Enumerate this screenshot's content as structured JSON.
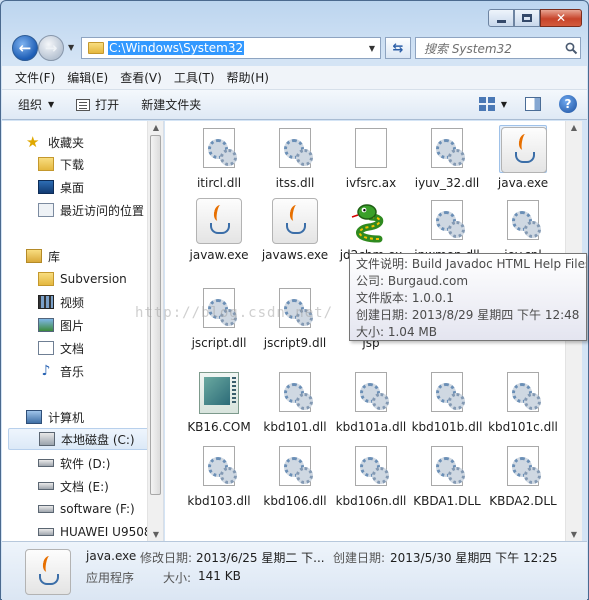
{
  "window": {
    "address": "C:\\Windows\\System32",
    "search_placeholder": "搜索 System32"
  },
  "menubar": [
    "文件(F)",
    "编辑(E)",
    "查看(V)",
    "工具(T)",
    "帮助(H)"
  ],
  "commandbar": {
    "organize": "组织",
    "open": "打开",
    "new_folder": "新建文件夹"
  },
  "navpane": {
    "favorites": "收藏夹",
    "downloads": "下载",
    "desktop": "桌面",
    "recent": "最近访问的位置",
    "libraries": "库",
    "subversion": "Subversion",
    "videos": "视频",
    "pictures": "图片",
    "documents": "文档",
    "music": "音乐",
    "computer": "计算机",
    "drive_c": "本地磁盘 (C:)",
    "drive_d": "软件 (D:)",
    "drive_e": "文档 (E:)",
    "drive_f": "software (F:)",
    "drive_huawei": "HUAWEI U9508"
  },
  "files": [
    {
      "name": "itircl.dll",
      "icon": "dll"
    },
    {
      "name": "itss.dll",
      "icon": "dll"
    },
    {
      "name": "ivfsrc.ax",
      "icon": "blank"
    },
    {
      "name": "iyuv_32.dll",
      "icon": "dll"
    },
    {
      "name": "java.exe",
      "icon": "java"
    },
    {
      "name": "javaw.exe",
      "icon": "java"
    },
    {
      "name": "javaws.exe",
      "icon": "java"
    },
    {
      "name": "jd2chm.ex",
      "icon": "snake"
    },
    {
      "name": "jnwmon.dll",
      "icon": "dll"
    },
    {
      "name": "joy.cpl",
      "icon": "dll"
    },
    {
      "name": "jscript.dll",
      "icon": "dll"
    },
    {
      "name": "jscript9.dll",
      "icon": "dll"
    },
    {
      "name": "jsp",
      "icon": "dll"
    },
    {
      "name": "",
      "icon": "dll"
    },
    {
      "name": "",
      "icon": "dll"
    },
    {
      "name": "KB16.COM",
      "icon": "com"
    },
    {
      "name": "kbd101.dll",
      "icon": "dll"
    },
    {
      "name": "kbd101a.dll",
      "icon": "dll"
    },
    {
      "name": "kbd101b.dll",
      "icon": "dll"
    },
    {
      "name": "kbd101c.dll",
      "icon": "dll"
    },
    {
      "name": "kbd103.dll",
      "icon": "dll"
    },
    {
      "name": "kbd106.dll",
      "icon": "dll"
    },
    {
      "name": "kbd106n.dll",
      "icon": "dll"
    },
    {
      "name": "KBDA1.DLL",
      "icon": "dll"
    },
    {
      "name": "KBDA2.DLL",
      "icon": "dll"
    }
  ],
  "tooltip": {
    "line1": "文件说明: Build Javadoc HTML Help Files",
    "line2": "公司: Burgaud.com",
    "line3": "文件版本: 1.0.0.1",
    "line4": "创建日期: 2013/8/29 星期四 下午 12:48",
    "line5": "大小: 1.04 MB"
  },
  "watermark": "http://blog.csdn.net/",
  "details": {
    "filename": "java.exe",
    "modified_label": "修改日期:",
    "modified_value": "2013/6/25 星期二 下...",
    "created_label": "创建日期:",
    "created_value": "2013/5/30 星期四 下午 12:25",
    "type": "应用程序",
    "size_label": "大小:",
    "size_value": "141 KB"
  }
}
